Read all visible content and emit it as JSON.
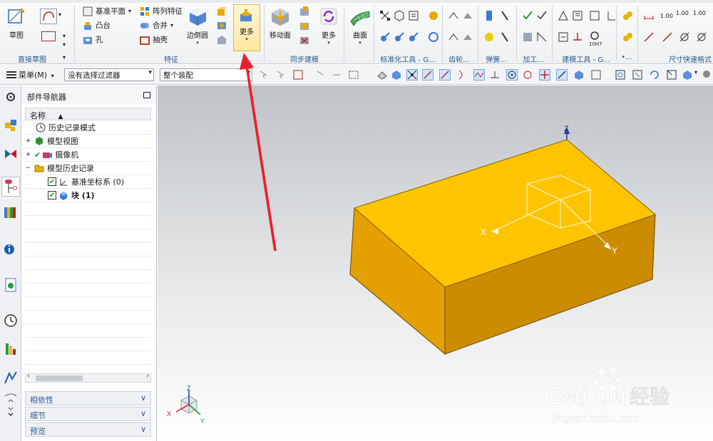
{
  "ribbon": {
    "groups": {
      "direct_sketch": "直接草图",
      "feature": "特征",
      "sync_modeling": "同步建模",
      "standard_tools": "标准化工具 - G...",
      "gear": "齿轮...",
      "spring": "弹簧...",
      "machining": "加工...",
      "modeling_tools": "建模工具 - G...",
      "misc": "•...",
      "dimension_quick": "尺寸快速格式"
    },
    "buttons": {
      "sketch": "草图",
      "datum_plane": "基准平面",
      "pattern_feature": "阵列特征",
      "boss": "凸台",
      "unite": "合并",
      "hole": "孔",
      "shell": "抽壳",
      "edge_blend": "边倒圆",
      "more_feature": "更多",
      "move_face": "移动面",
      "more_sync": "更多",
      "surface": "曲面"
    },
    "small_labels": {
      "n100": "1.00",
      "n100b": "1.00",
      "n100c": "1.00",
      "h7": "10H7"
    }
  },
  "toolbar": {
    "menu": "菜单(M)",
    "filter": "没有选择过滤器",
    "assembly": "整个装配"
  },
  "navigator": {
    "title": "部件导航器",
    "col_name": "名称",
    "rows": [
      {
        "label": "历史记录模式"
      },
      {
        "label": "模型视图"
      },
      {
        "label": "摄像机"
      },
      {
        "label": "模型历史记录"
      },
      {
        "label": "基准坐标系 (0)"
      },
      {
        "label": "块 (1)"
      }
    ],
    "panels": {
      "dependency": "相依性",
      "details": "细节",
      "preview": "预览"
    }
  },
  "viewport": {
    "csys_x": "X",
    "csys_y": "Y",
    "csys_z": "Z",
    "tri_x": "X",
    "tri_y": "Y",
    "tri_z": "Z",
    "block_top_color": "#FFC400",
    "block_side_color": "#E3A000",
    "block_front_color": "#CC8C00",
    "watermark_brand": "Bai",
    "watermark_brand2": "du",
    "watermark_cn": "经验",
    "watermark_url": "jingyan.baidu.com"
  },
  "colors": {
    "arrow": "#E8202A",
    "highlight": "#FFE7A0"
  }
}
